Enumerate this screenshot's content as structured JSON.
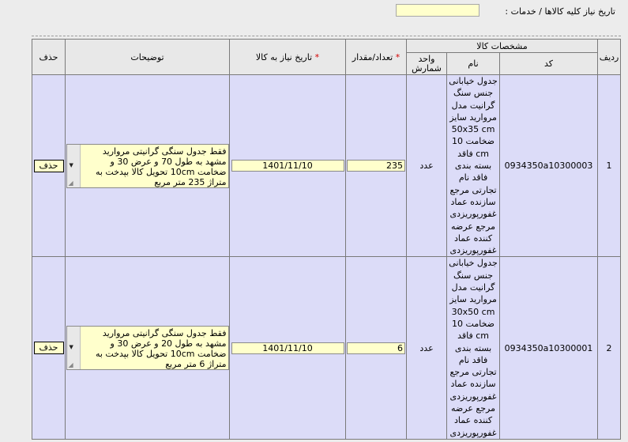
{
  "header": {
    "date_label": "تاریخ نیاز کلیه کالاها / خدمات :",
    "date_value": ""
  },
  "table": {
    "columns": {
      "row": "ردیف",
      "spec_group": "مشخصات کالا",
      "code": "کد",
      "name": "نام",
      "unit": "واحد شمارش",
      "qty": "تعداد/مقدار",
      "need_date": "تاریخ نیاز به کالا",
      "desc": "توضیحات",
      "delete": "حذف"
    },
    "rows": [
      {
        "index": "1",
        "code": "0934350a10300003",
        "name": "جدول خیابانی جنس سنگ گرانیت مدل مروارید سایز 50x35 cm ضخامت 10 cm فاقد بسته بندی فاقد نام تجارتی مرجع سازنده عماد غفورپوریزدی مرجع عرضه کننده عماد غفورپوریزدی",
        "unit": "عدد",
        "qty": "235",
        "need_date": "1401/11/10",
        "desc": "فقط جدول سنگی گرانیتی مروارید مشهد به طول 70  و عرض 30 و ضخامت 10cm تحویل کالا  بپدخت به متراژ 235 متر مربع",
        "delete_label": "حذف"
      },
      {
        "index": "2",
        "code": "0934350a10300001",
        "name": "جدول خیابانی جنس سنگ گرانیت مدل مروارید سایز 30x50 cm ضخامت 10 cm فاقد بسته بندی فاقد نام تجارتی مرجع سازنده عماد غفورپوریزدی مرجع عرضه کننده عماد غفورپوریزدی",
        "unit": "عدد",
        "qty": "6",
        "need_date": "1401/11/10",
        "desc": "فقط جدول سنگی گرانیتی مروارید مشهد به طول 20  و عرض 30 و ضخامت 10cm تحویل کالا  بپدخت به متراژ 6 متر مربع",
        "delete_label": "حذف"
      }
    ]
  }
}
